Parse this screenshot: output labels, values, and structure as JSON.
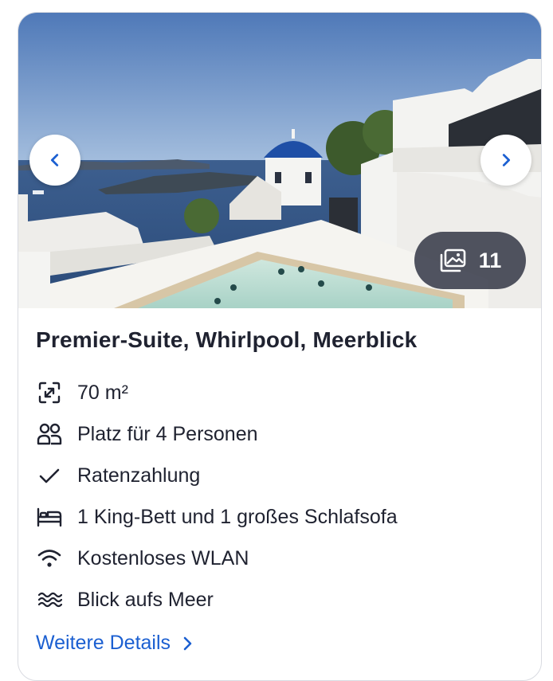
{
  "gallery": {
    "photo_count": "11"
  },
  "room": {
    "title": "Premier-Suite, Whirlpool, Meerblick",
    "amenities": [
      {
        "icon": "area-expand-icon",
        "label": "70 m²"
      },
      {
        "icon": "people-icon",
        "label": "Platz für 4 Personen"
      },
      {
        "icon": "checkmark-icon",
        "label": "Ratenzahlung"
      },
      {
        "icon": "bed-icon",
        "label": "1 King-Bett und 1 großes Schlafsofa"
      },
      {
        "icon": "wifi-icon",
        "label": "Kostenloses WLAN"
      },
      {
        "icon": "waves-icon",
        "label": "Blick aufs Meer"
      }
    ],
    "details_link": "Weitere Details"
  },
  "colors": {
    "link": "#1b5fd1",
    "text": "#1f2230",
    "badge": "#2c2f40",
    "nav_arrow": "#1b5fd1"
  }
}
